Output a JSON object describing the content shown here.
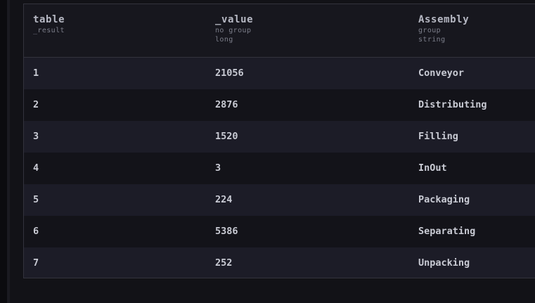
{
  "table": {
    "columns": [
      {
        "name": "table",
        "meta": [
          "_result"
        ]
      },
      {
        "name": "_value",
        "meta": [
          "no group",
          "long"
        ]
      },
      {
        "name": "Assembly",
        "meta": [
          "group",
          "string"
        ]
      }
    ],
    "rows": [
      {
        "table": "1",
        "value": "21056",
        "assembly": "Conveyor"
      },
      {
        "table": "2",
        "value": "2876",
        "assembly": "Distributing"
      },
      {
        "table": "3",
        "value": "1520",
        "assembly": "Filling"
      },
      {
        "table": "4",
        "value": "3",
        "assembly": "InOut"
      },
      {
        "table": "5",
        "value": "224",
        "assembly": "Packaging"
      },
      {
        "table": "6",
        "value": "5386",
        "assembly": "Separating"
      },
      {
        "table": "7",
        "value": "252",
        "assembly": "Unpacking"
      }
    ]
  }
}
